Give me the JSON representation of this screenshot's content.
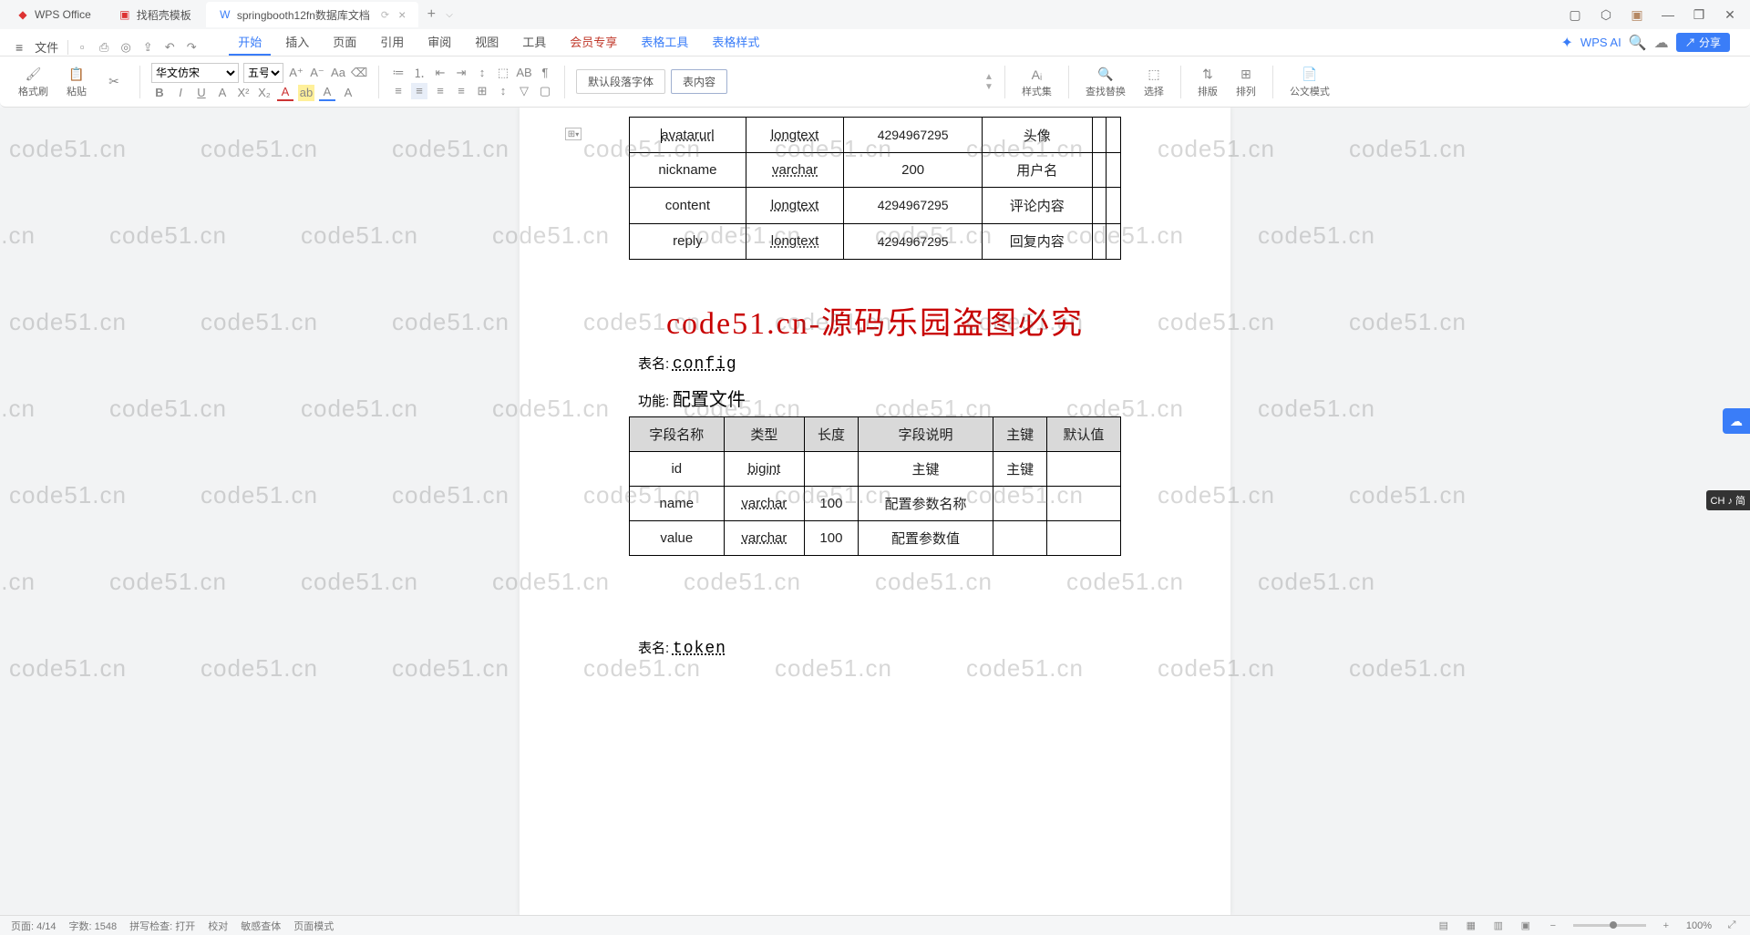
{
  "tabs": {
    "t0": "WPS Office",
    "t1": "找稻壳模板",
    "t2": "springbooth12fn数据库文档",
    "add": "+"
  },
  "window": {
    "min": "—",
    "max": "❐",
    "close": "✕"
  },
  "menu": {
    "file": "文件",
    "items": [
      "开始",
      "插入",
      "页面",
      "引用",
      "审阅",
      "视图",
      "工具",
      "会员专享",
      "表格工具",
      "表格样式"
    ],
    "ai": "WPS AI",
    "share": "分享"
  },
  "ribbon": {
    "format_brush": "格式刷",
    "paste": "粘贴",
    "font_name": "华文仿宋",
    "font_size": "五号",
    "style_default": "默认段落字体",
    "style_table": "表内容",
    "style_group": "样式集",
    "find": "查找替换",
    "select": "选择",
    "sort": "排版",
    "arrange": "排列",
    "gongwen": "公文模式"
  },
  "doc": {
    "table1": {
      "rows": [
        {
          "c0": "avatarurl",
          "c1": "longtext",
          "c2": "4294967295",
          "c3": "头像",
          "c4": "",
          "c5": ""
        },
        {
          "c0": "nickname",
          "c1": "varchar",
          "c2": "200",
          "c3": "用户名",
          "c4": "",
          "c5": ""
        },
        {
          "c0": "content",
          "c1": "longtext",
          "c2": "4294967295",
          "c3": "评论内容",
          "c4": "",
          "c5": ""
        },
        {
          "c0": "reply",
          "c1": "longtext",
          "c2": "4294967295",
          "c3": "回复内容",
          "c4": "",
          "c5": ""
        }
      ]
    },
    "watermark_text": "code51.cn-源码乐园盗图必究",
    "table2": {
      "name_label": "表名:",
      "name": "config",
      "func_label": "功能:",
      "func": "配置文件",
      "headers": [
        "字段名称",
        "类型",
        "长度",
        "字段说明",
        "主键",
        "默认值"
      ],
      "rows": [
        {
          "c0": "id",
          "c1": "bigint",
          "c2": "",
          "c3": "主键",
          "c4": "主键",
          "c5": ""
        },
        {
          "c0": "name",
          "c1": "varchar",
          "c2": "100",
          "c3": "配置参数名称",
          "c4": "",
          "c5": ""
        },
        {
          "c0": "value",
          "c1": "varchar",
          "c2": "100",
          "c3": "配置参数值",
          "c4": "",
          "c5": ""
        }
      ]
    },
    "table3": {
      "name_label": "表名:",
      "name": "token"
    }
  },
  "wm": "code51.cn",
  "lang": "CH ♪ 简",
  "status": {
    "page": "页面: 4/14",
    "words": "字数: 1548",
    "spell": "拼写检查: 打开",
    "proof": "校对",
    "insert": "敏感查体",
    "layout": "页面模式",
    "zoom": "100%"
  }
}
